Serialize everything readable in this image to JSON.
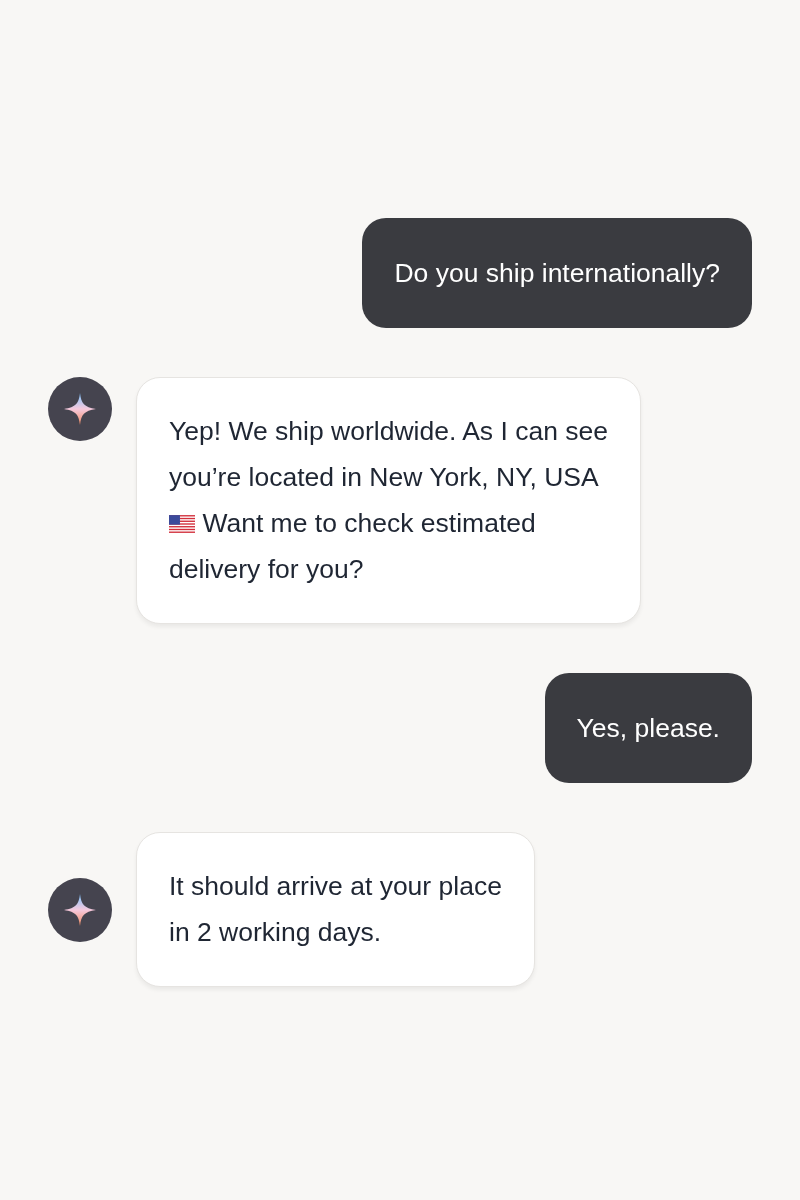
{
  "messages": [
    {
      "kind": "user",
      "lines": [
        {
          "text": "Do you ship internationally?"
        }
      ]
    },
    {
      "kind": "assistant",
      "lines": [
        {
          "text": "Yep! We ship worldwide. As I can see"
        },
        {
          "text": "you’re located in New York, NY, USA"
        },
        {
          "text": "Want me to check estimated",
          "flag": true
        },
        {
          "text": "delivery for you?"
        }
      ]
    },
    {
      "kind": "user",
      "lines": [
        {
          "text": "Yes, please."
        }
      ]
    },
    {
      "kind": "assistant",
      "lines": [
        {
          "text": "It should arrive at your place"
        },
        {
          "text": "in 2 working days."
        }
      ]
    }
  ]
}
